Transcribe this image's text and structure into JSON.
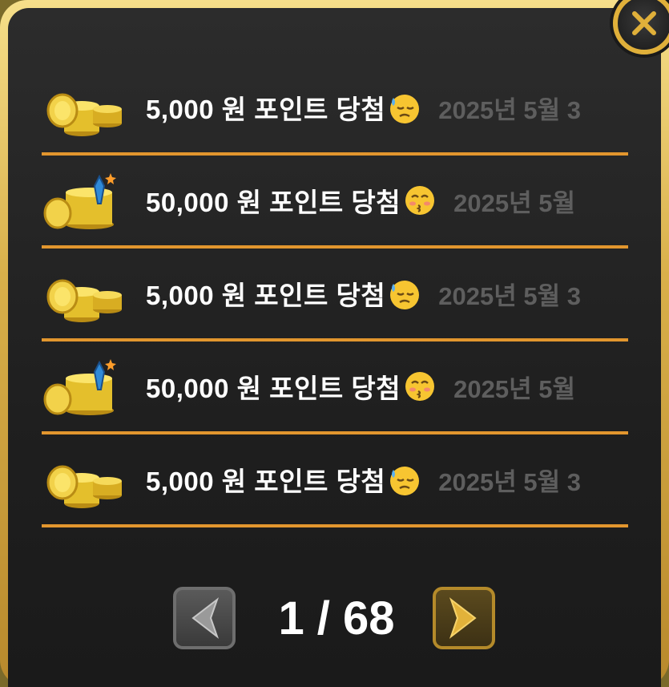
{
  "dialog": {
    "close_icon": "close-icon",
    "accent_color": "#e2962e"
  },
  "rows": [
    {
      "text": "5,000 원 포인트 당첨",
      "emoji": "sweat-face",
      "date": "2025년 5월 3",
      "icon": "gold-coins-icon"
    },
    {
      "text": "50,000 원 포인트 당첨",
      "emoji": "kissing-face",
      "date": "2025년 5월",
      "icon": "gold-coins-potion-icon"
    },
    {
      "text": "5,000 원 포인트 당첨",
      "emoji": "sweat-face",
      "date": "2025년 5월 3",
      "icon": "gold-coins-icon"
    },
    {
      "text": "50,000 원 포인트 당첨",
      "emoji": "kissing-face",
      "date": "2025년 5월",
      "icon": "gold-coins-potion-icon"
    },
    {
      "text": "5,000 원 포인트 당첨",
      "emoji": "sweat-face",
      "date": "2025년 5월 3",
      "icon": "gold-coins-icon"
    }
  ],
  "pager": {
    "indicator": "1 / 68",
    "prev_icon": "chevron-left-icon",
    "next_icon": "chevron-right-icon"
  }
}
